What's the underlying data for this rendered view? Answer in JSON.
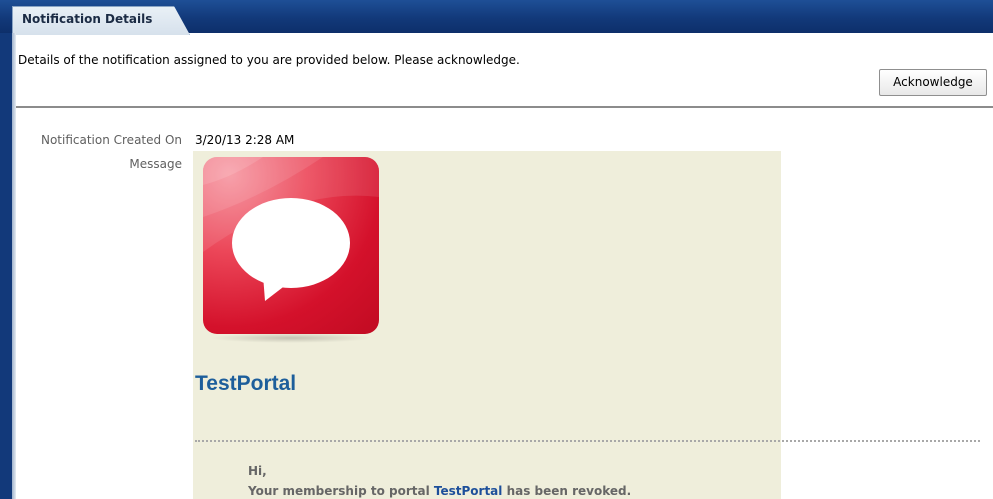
{
  "tab": {
    "label": "Notification Details"
  },
  "header": {
    "instructions": "Details of the notification assigned to you are provided below. Please acknowledge.",
    "acknowledge_label": "Acknowledge"
  },
  "fields": {
    "created_on_label": "Notification Created On",
    "created_on_value": "3/20/13 2:28 AM",
    "message_label": "Message"
  },
  "message": {
    "icon": "speech-bubble-icon",
    "portal_name": "TestPortal",
    "greeting": "Hi,",
    "body_prefix": "Your membership to portal ",
    "body_link": "TestPortal",
    "body_suffix": " has been revoked."
  },
  "colors": {
    "header_blue": "#12397a",
    "portal_title": "#1d5e9b",
    "message_bg": "#efeedb",
    "icon_red": "#d4112b"
  }
}
